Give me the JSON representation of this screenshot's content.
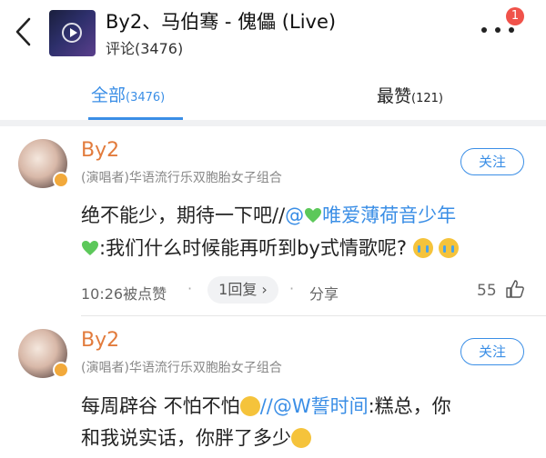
{
  "header": {
    "title": "By2、马伯骞 - 傀儡 (Live)",
    "subtitle": "评论(3476)",
    "notification_count": "1",
    "accent_color": "#3a8ee6"
  },
  "tabs": {
    "all_label": "全部",
    "all_count": "(3476)",
    "likes_label": "最赞",
    "likes_count": "(121)"
  },
  "comments": [
    {
      "user": "By2",
      "role": "(演唱者)华语流行乐双胞胎女子组合",
      "follow_label": "关注",
      "line1_text": "绝不能少，期待一下吧//",
      "line1_mention": "@",
      "line1_mention_name": "唯爱薄荷音少年",
      "line2_text": ":我们什么时候能再听到by式情歌呢?",
      "meta_time": "10:26被点赞",
      "reply_label": "1回复",
      "share_label": "分享",
      "like_count": "55"
    },
    {
      "user": "By2",
      "role": "(演唱者)华语流行乐双胞胎女子组合",
      "follow_label": "关注",
      "line1_text": "每周辟谷 不怕不怕",
      "line1_mention": "//@W誓时间",
      "line1_rest": ":糕总，你",
      "line2_text": "和我说实话，你胖了多少"
    }
  ]
}
